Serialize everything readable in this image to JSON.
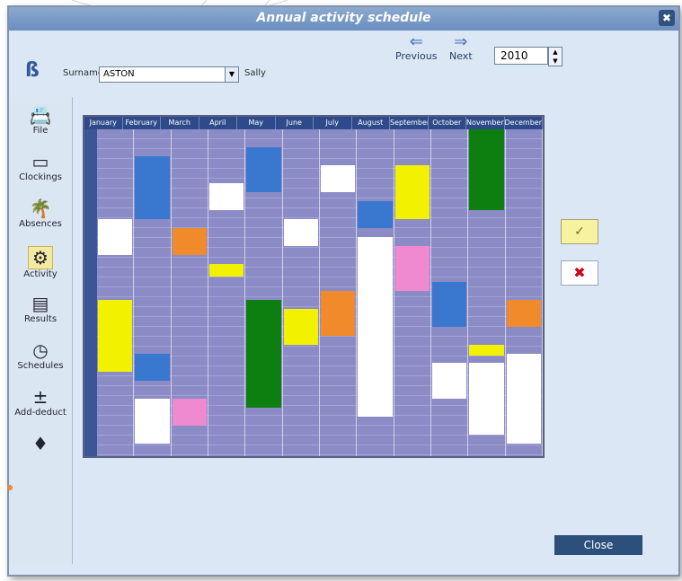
{
  "window": {
    "title": "Annual activity schedule",
    "close_glyph": "✖"
  },
  "toolbar": {
    "previous_label": "Previous",
    "next_label": "Next",
    "previous_icon": "arrow-left-icon",
    "next_icon": "arrow-right-icon"
  },
  "year": {
    "value": "2010"
  },
  "employee": {
    "surname_label": "Surname",
    "surname_value": "ASTON",
    "first_name": "Sally"
  },
  "sidebar": {
    "items": [
      {
        "label": "File",
        "icon": "file-icon",
        "glyph": "📇"
      },
      {
        "label": "Clockings",
        "icon": "card-reader-icon",
        "glyph": "▭"
      },
      {
        "label": "Absences",
        "icon": "palm-tree-icon",
        "glyph": "🌴"
      },
      {
        "label": "Activity",
        "icon": "activity-icon",
        "glyph": "⚙"
      },
      {
        "label": "Results",
        "icon": "results-icon",
        "glyph": "▤"
      },
      {
        "label": "Schedules",
        "icon": "clock-icon",
        "glyph": "◷"
      },
      {
        "label": "Add-deduct",
        "icon": "plus-minus-icon",
        "glyph": "±"
      },
      {
        "label": "",
        "icon": "award-icon",
        "glyph": "♦"
      }
    ]
  },
  "schedule": {
    "months": [
      "January",
      "February",
      "March",
      "April",
      "May",
      "June",
      "July",
      "August",
      "September",
      "October",
      "November",
      "December"
    ]
  },
  "actions": {
    "ok_glyph": "✓",
    "cancel_glyph": "✖",
    "close_label": "Close"
  }
}
